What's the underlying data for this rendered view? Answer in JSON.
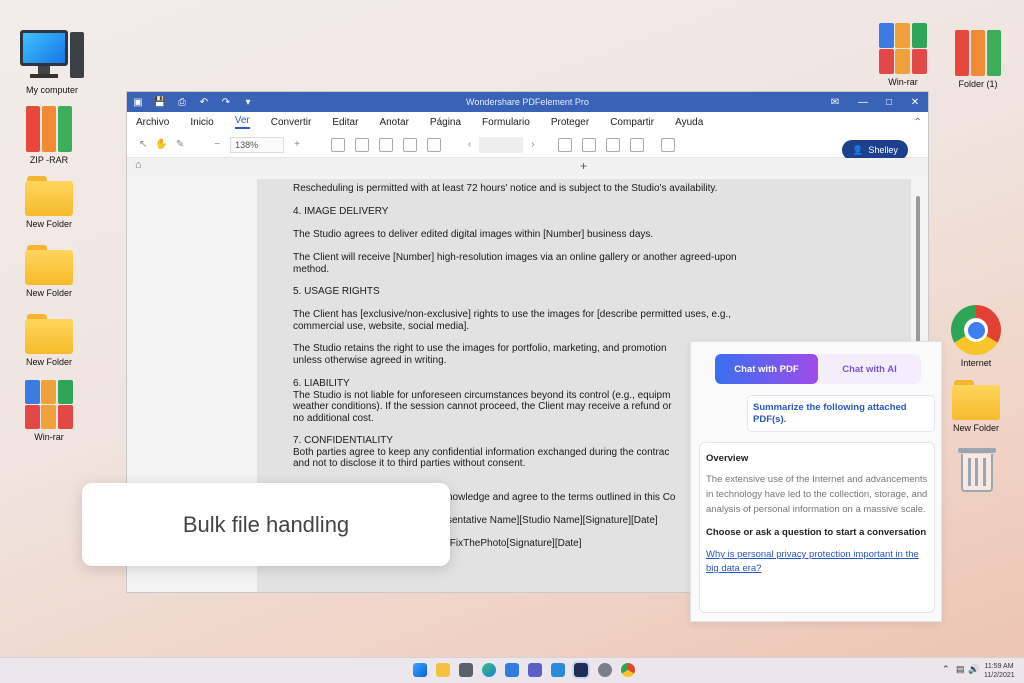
{
  "desktop": {
    "left_icons": [
      {
        "label": "My computer"
      },
      {
        "label": "ZIP -RAR"
      },
      {
        "label": "New Folder"
      },
      {
        "label": "New Folder"
      },
      {
        "label": "New Folder"
      },
      {
        "label": "Win-rar"
      }
    ],
    "right_icons": [
      {
        "label": "Win-rar"
      },
      {
        "label": "Folder (1)"
      },
      {
        "label": "Internet"
      },
      {
        "label": "New Folder"
      }
    ]
  },
  "window": {
    "title": "Wondershare PDFelement Pro",
    "menu": [
      "Archivo",
      "Inicio",
      "Ver",
      "Convertir",
      "Editar",
      "Anotar",
      "Página",
      "Formulario",
      "Proteger",
      "Compartir",
      "Ayuda"
    ],
    "active_menu": "Ver",
    "zoom": "138%",
    "user": "Shelley",
    "new_tab": "+"
  },
  "document": {
    "paragraphs": [
      "Rescheduling is permitted with at least 72 hours' notice and is subject to the Studio's availability.",
      "4. IMAGE DELIVERY",
      "The Studio agrees to deliver edited digital images within [Number] business days.",
      "The Client will receive [Number] high-resolution images via an online gallery or another agreed-upon",
      "method.",
      "5. USAGE RIGHTS",
      "The Client has [exclusive/non-exclusive] rights to use the images for [describe permitted uses, e.g.,",
      "commercial use, website, social media].",
      "The Studio retains the right to use the images for portfolio, marketing, and promotion",
      "unless otherwise agreed in writing.",
      "6. LIABILITY",
      "The Studio is not liable for unforeseen circumstances beyond its control (e.g., equipm",
      "weather conditions). If the session cannot proceed, the Client may receive a refund or",
      "no additional cost.",
      "7. CONFIDENTIALITY",
      "Both parties agree to keep any confidential information exchanged during the contrac",
      "and not to disclose it to third parties without consent.",
      "nowledge and agree to the terms outlined in this Co",
      "sentative Name][Studio Name][Signature][Date]",
      "]FixThePhoto[Signature][Date]"
    ]
  },
  "chat": {
    "tab_pdf": "Chat with PDF",
    "tab_ai": "Chat with AI",
    "prompt": "Summarize the following attached PDF(s).",
    "overview_title": "Overview",
    "overview_text": "The extensive use of the Internet and advancements in technology have led to the collection, storage, and analysis of personal information on a massive scale.",
    "question_title": "Choose or ask a question to start a conversation",
    "suggestion": "Why is personal privacy protection important in the big data era?"
  },
  "callout": "Bulk file handling",
  "taskbar": {
    "time": "11:59 AM",
    "date": "11/2/2021"
  }
}
